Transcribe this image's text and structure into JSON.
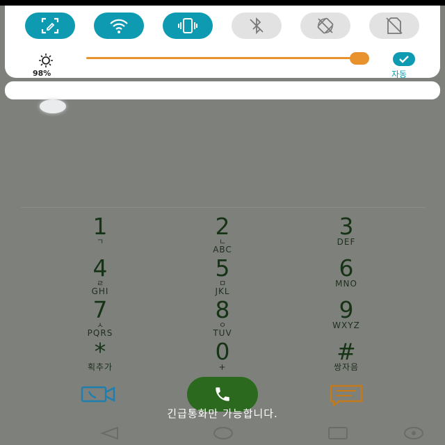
{
  "quick_settings": {
    "toggles": [
      {
        "icon": "screen-capture-icon",
        "state": "on"
      },
      {
        "icon": "wifi-icon",
        "state": "on"
      },
      {
        "icon": "vibrate-icon",
        "state": "on"
      },
      {
        "icon": "bluetooth-off-icon",
        "state": "off"
      },
      {
        "icon": "screen-rotation-off-icon",
        "state": "off"
      },
      {
        "icon": "no-sim-icon",
        "state": "off"
      }
    ],
    "brightness": {
      "percent_label": "98%",
      "level": 0.98,
      "auto_label": "자동"
    }
  },
  "dialpad": {
    "keys": [
      {
        "digit": "1",
        "sub": "ㄱ",
        "sub2": ""
      },
      {
        "digit": "2",
        "sub": "ㄴ",
        "sub2": "ABC"
      },
      {
        "digit": "3",
        "sub": "",
        "sub2": "DEF"
      },
      {
        "digit": "4",
        "sub": "ㄹ",
        "sub2": "GHI"
      },
      {
        "digit": "5",
        "sub": "ㅁ",
        "sub2": "JKL"
      },
      {
        "digit": "6",
        "sub": "",
        "sub2": "MNO"
      },
      {
        "digit": "7",
        "sub": "ㅅ",
        "sub2": "PQRS"
      },
      {
        "digit": "8",
        "sub": "ㅇ",
        "sub2": "TUV"
      },
      {
        "digit": "9",
        "sub": "",
        "sub2": "WXYZ"
      },
      {
        "digit": "*",
        "sub": "",
        "sub2": "획추가"
      },
      {
        "digit": "0",
        "sub": "",
        "sub2": "+"
      },
      {
        "digit": "#",
        "sub": "",
        "sub2": "쌍자음"
      }
    ],
    "emergency_text": "긴급통화만 가능합니다."
  },
  "colors": {
    "accent": "#0e9bb2",
    "slider": "#e8922d",
    "call": "#2b6a1e"
  }
}
